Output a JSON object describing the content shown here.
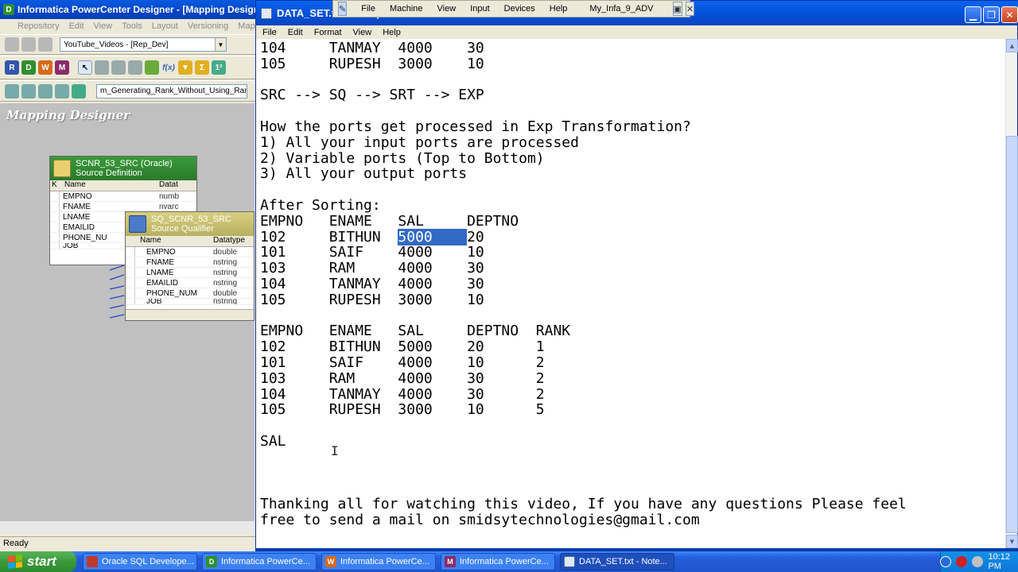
{
  "informatica": {
    "title": "Informatica PowerCenter Designer - [Mapping Designer]",
    "menu": [
      "Repository",
      "Edit",
      "View",
      "Tools",
      "Layout",
      "Versioning",
      "Mappings"
    ],
    "folder_combo": "YouTube_Videos - [Rep_Dev]",
    "mapping_combo": "m_Generating_Rank_Without_Using_Rank",
    "workspace_title": "Mapping Designer",
    "source_def": {
      "name": "SCNR_53_SRC (Oracle)",
      "subtitle": "Source Definition",
      "col_key": "K",
      "col_name": "Name",
      "col_type": "Datat",
      "rows": [
        {
          "name": "EMPNO",
          "type": "numb"
        },
        {
          "name": "FNAME",
          "type": "nvarc"
        },
        {
          "name": "LNAME",
          "type": "nvarc"
        },
        {
          "name": "EMAILID",
          "type": "nvarc"
        },
        {
          "name": "PHONE_NU",
          "type": "numb"
        },
        {
          "name": "JOB",
          "type": "nvarc"
        }
      ]
    },
    "source_qual": {
      "name": "SQ_SCNR_53_SRC",
      "subtitle": "Source Qualifier",
      "col_name": "Name",
      "col_type": "Datatype",
      "rows": [
        {
          "name": "EMPNO",
          "type": "double"
        },
        {
          "name": "FNAME",
          "type": "nstring"
        },
        {
          "name": "LNAME",
          "type": "nstring"
        },
        {
          "name": "EMAILID",
          "type": "nstring"
        },
        {
          "name": "PHONE_NUM",
          "type": "double"
        },
        {
          "name": "JOB",
          "type": "nstring"
        }
      ]
    },
    "status": "Ready"
  },
  "vm_toolbar": {
    "items": [
      "File",
      "Machine",
      "View",
      "Input",
      "Devices",
      "Help"
    ],
    "vm_name": "My_Infa_9_ADV"
  },
  "notepad": {
    "title": "DATA_SET.txt - Notepad",
    "menu": [
      "File",
      "Edit",
      "Format",
      "View",
      "Help"
    ],
    "lines_before": "104     TANMAY  4000    30\n105     RUPESH  3000    10\n\nSRC --> SQ --> SRT --> EXP\n\nHow the ports get processed in Exp Transformation?\n1) All your input ports are processed\n2) Variable ports (Top to Bottom)\n3) All your output ports\n\nAfter Sorting:\nEMPNO   ENAME   SAL     DEPTNO\n102     BITHUN  ",
    "selected": "5000    ",
    "lines_after": "20\n101     SAIF    4000    10\n103     RAM     4000    30\n104     TANMAY  4000    30\n105     RUPESH  3000    10\n\nEMPNO   ENAME   SAL     DEPTNO  RANK\n102     BITHUN  5000    20      1\n101     SAIF    4000    10      2\n103     RAM     4000    30      2\n104     TANMAY  4000    30      2\n105     RUPESH  3000    10      5\n\nSAL\n\n\n\nThanking all for watching this video, If you have any questions Please feel\nfree to send a mail on smidsytechnologies@gmail.com"
  },
  "taskbar": {
    "start": "start",
    "tasks": [
      {
        "label": "Oracle SQL Develope...",
        "icon": "oracle-sql-icon"
      },
      {
        "label": "Informatica PowerCe...",
        "icon": "designer-icon"
      },
      {
        "label": "Informatica PowerCe...",
        "icon": "workflow-icon"
      },
      {
        "label": "Informatica PowerCe...",
        "icon": "monitor-icon"
      },
      {
        "label": "DATA_SET.txt - Note...",
        "icon": "notepad-icon"
      }
    ],
    "clock": "10:12 PM"
  }
}
